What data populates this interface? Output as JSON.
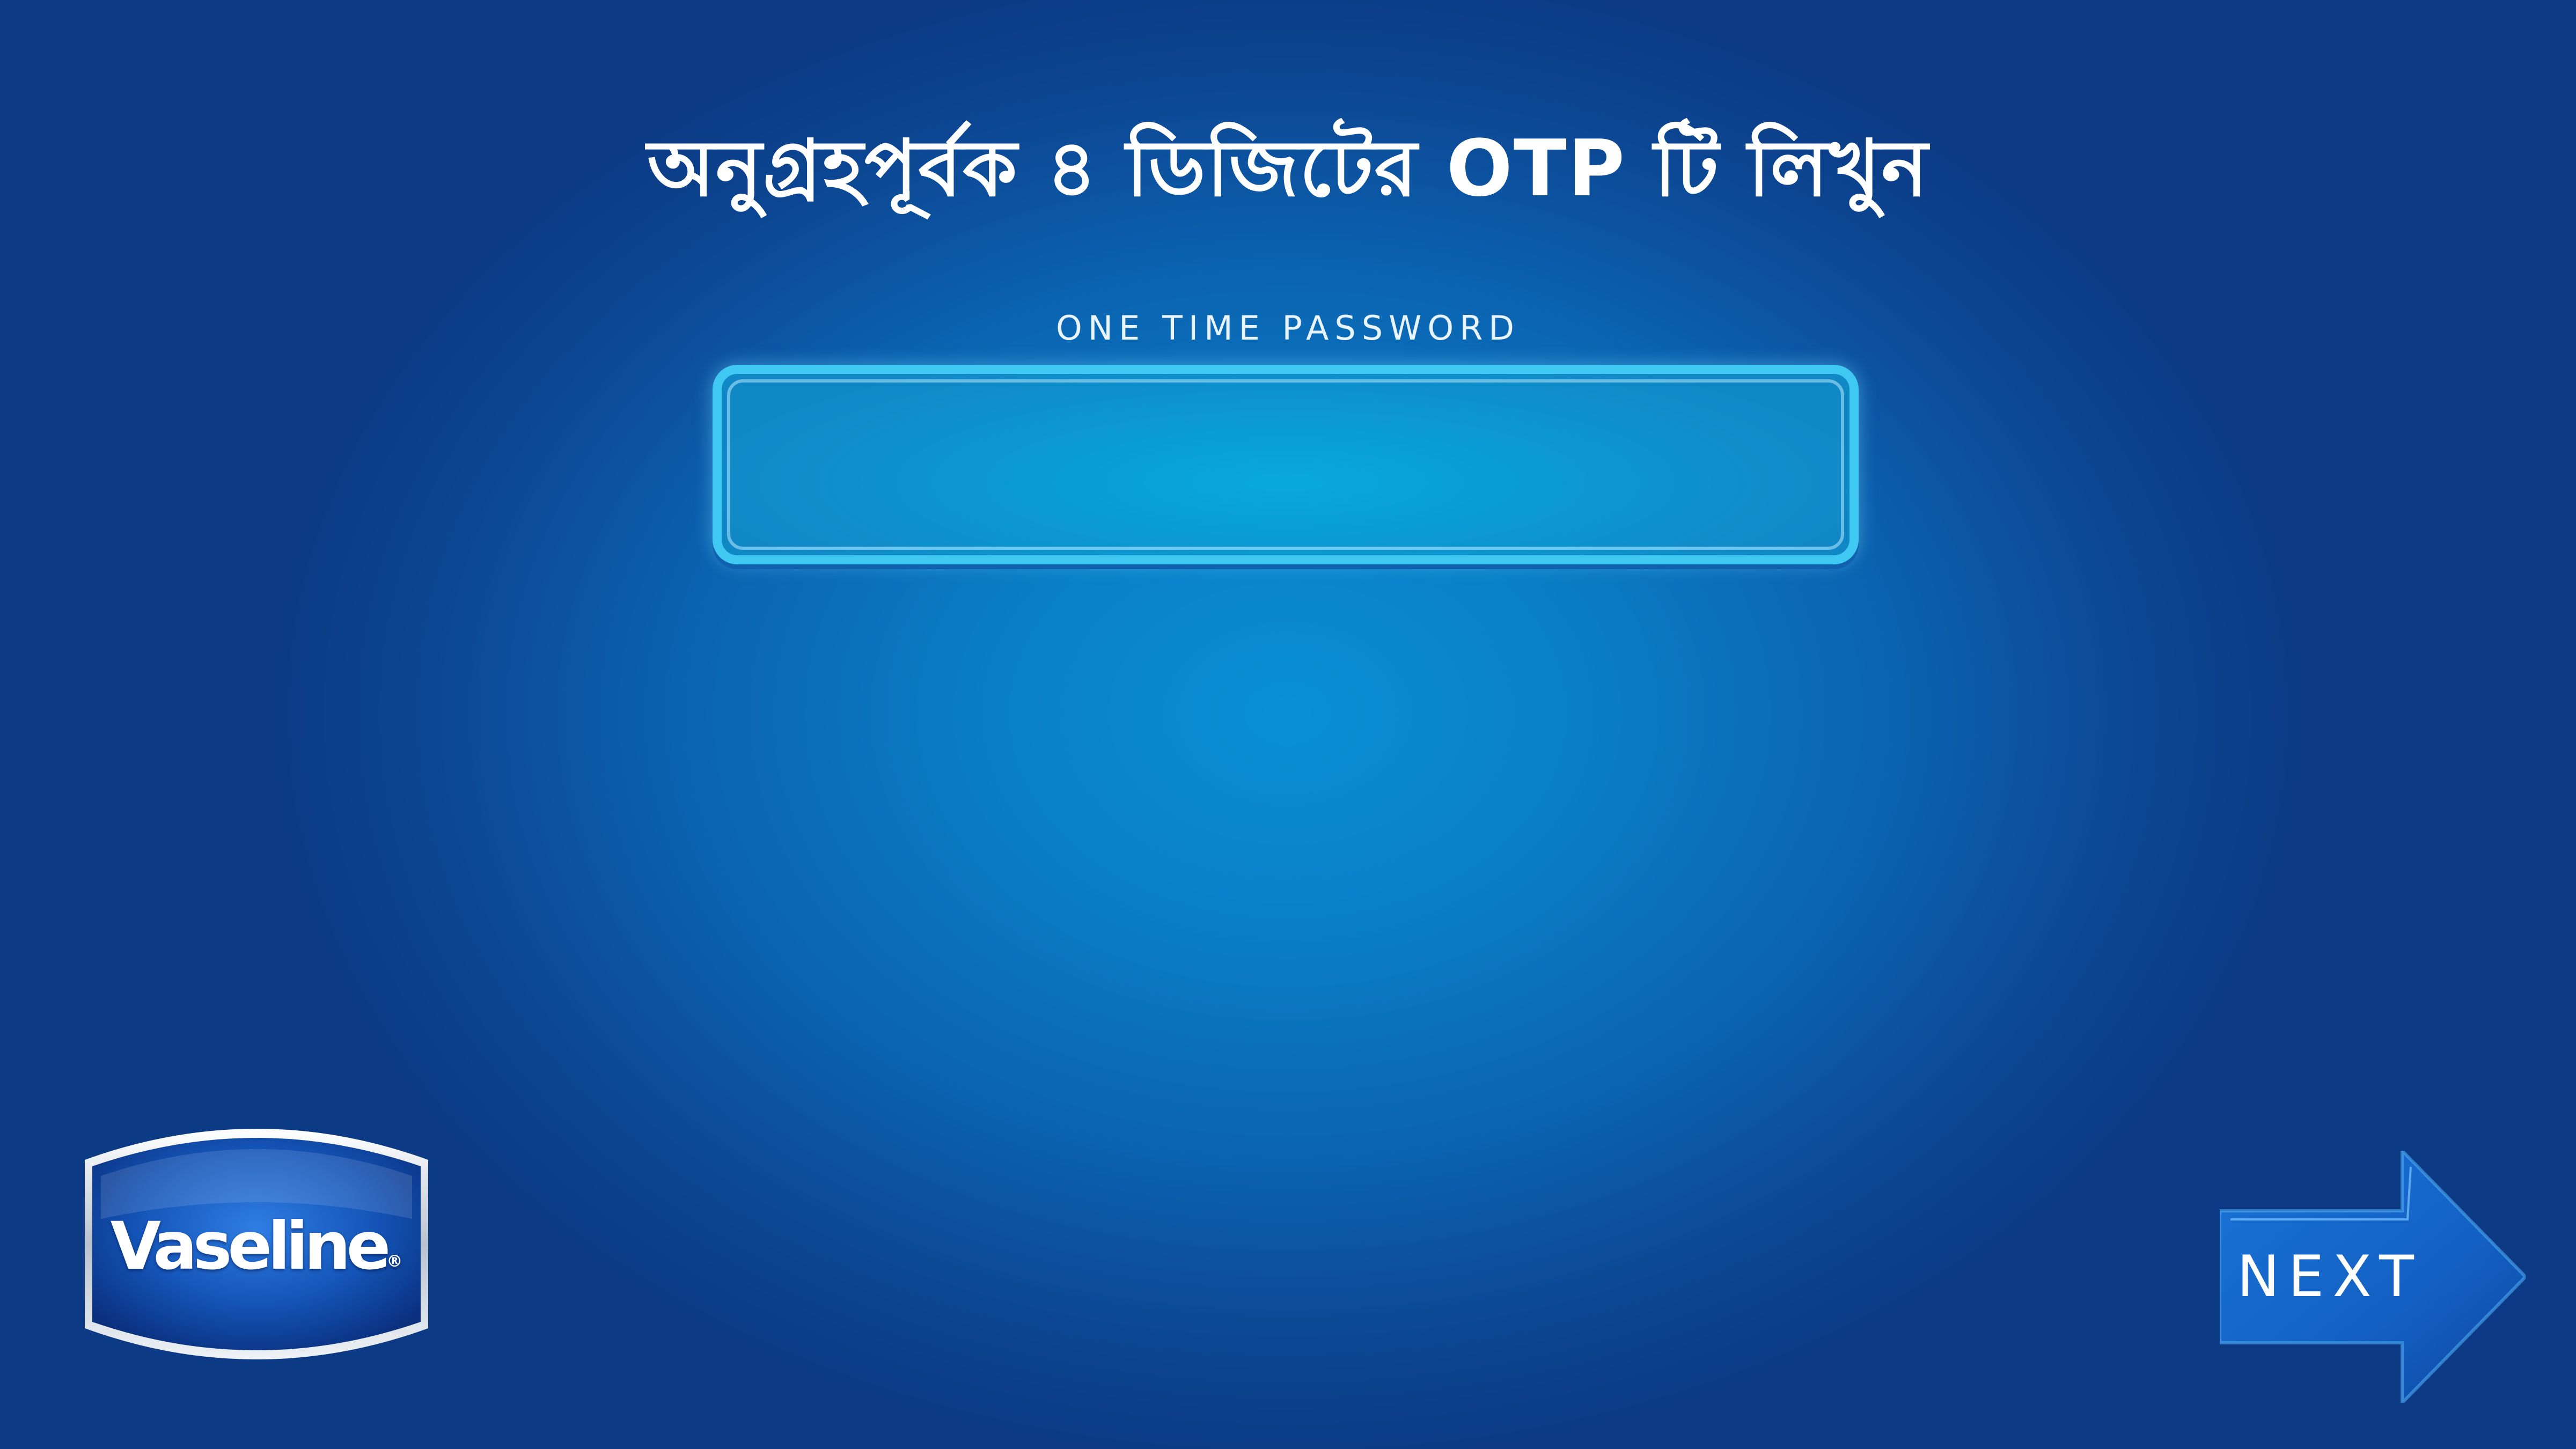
{
  "otp_screen": {
    "title": "অনুগ্রহপূর্বক ৪ ডিজিটের OTP টি লিখুন",
    "field_label": "ONE TIME PASSWORD",
    "field_value": "",
    "field_placeholder": ""
  },
  "brand": {
    "logo_text": "Vaseline",
    "registered_mark": "®"
  },
  "navigation": {
    "next_label": "NEXT",
    "next_icon": "right-arrow-icon"
  },
  "colors": {
    "background_center": "#0890d6",
    "background_edge": "#0c3a84",
    "input_border": "#3fc8f2",
    "logo_blue": "#0a3f94",
    "next_arrow": "#1565c8"
  }
}
